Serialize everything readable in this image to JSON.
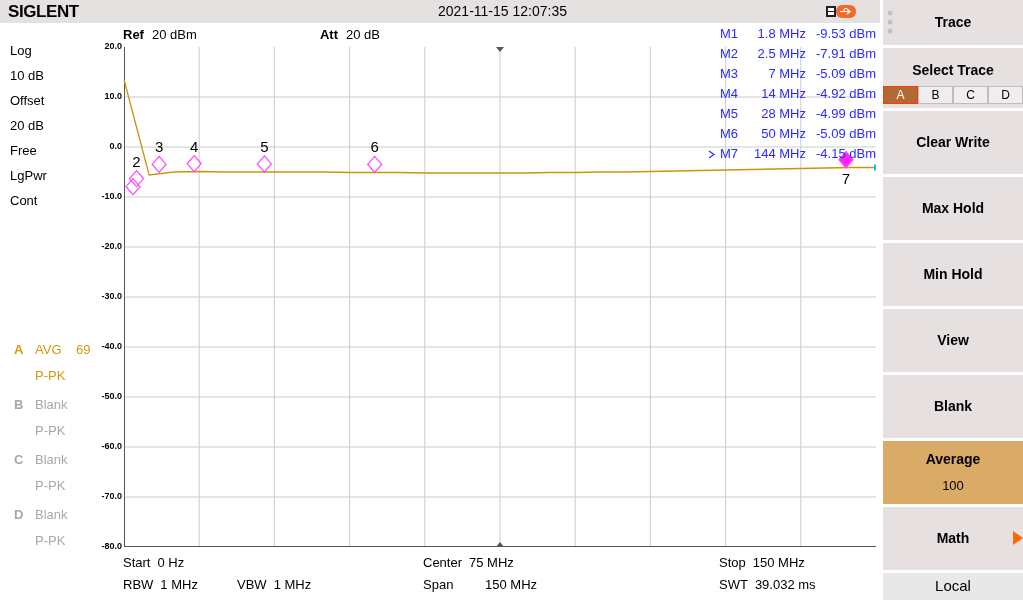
{
  "top_bar": {
    "brand": "SIGLENT",
    "datetime": "2021-11-15 12:07:35"
  },
  "settings": [
    "Log",
    "10 dB",
    "Offset",
    "20 dB",
    "Free",
    "LgPwr",
    "Cont"
  ],
  "traces": [
    {
      "letter": "A",
      "mode": "AVG",
      "count": "69",
      "detector": "P-PK",
      "active": true
    },
    {
      "letter": "B",
      "mode": "Blank",
      "detector": "P-PK",
      "active": false
    },
    {
      "letter": "C",
      "mode": "Blank",
      "detector": "P-PK",
      "active": false
    },
    {
      "letter": "D",
      "mode": "Blank",
      "detector": "P-PK",
      "active": false
    }
  ],
  "header": {
    "ref_label": "Ref",
    "ref_value": "20 dBm",
    "att_label": "Att",
    "att_value": "20 dB"
  },
  "markers": [
    {
      "name": "M1",
      "freq": "1.8 MHz",
      "amplitude": "-9.53 dBm",
      "selected": false
    },
    {
      "name": "M2",
      "freq": "2.5 MHz",
      "amplitude": "-7.91 dBm",
      "selected": false
    },
    {
      "name": "M3",
      "freq": "7 MHz",
      "amplitude": "-5.09 dBm",
      "selected": false
    },
    {
      "name": "M4",
      "freq": "14 MHz",
      "amplitude": "-4.92 dBm",
      "selected": false
    },
    {
      "name": "M5",
      "freq": "28 MHz",
      "amplitude": "-4.99 dBm",
      "selected": false
    },
    {
      "name": "M6",
      "freq": "50 MHz",
      "amplitude": "-5.09 dBm",
      "selected": false
    },
    {
      "name": "M7",
      "freq": "144 MHz",
      "amplitude": "-4.15 dBm",
      "selected": true
    }
  ],
  "plot": {
    "marker_labels": [
      "2",
      "3",
      "4",
      "5",
      "6",
      "7"
    ],
    "chart_data": {
      "type": "line",
      "ylim": [
        -80,
        20
      ],
      "grid": true,
      "yticks": [
        {
          "value": 20,
          "label": "20.0"
        },
        {
          "value": 10,
          "label": "10.0"
        },
        {
          "value": 0,
          "label": "0.0"
        },
        {
          "value": -10,
          "label": "-10.0"
        },
        {
          "value": -20,
          "label": "-20.0"
        },
        {
          "value": -30,
          "label": "-30.0"
        },
        {
          "value": -40,
          "label": "-40.0"
        },
        {
          "value": -50,
          "label": "-50.0"
        },
        {
          "value": -60,
          "label": "-60.0"
        },
        {
          "value": -70,
          "label": "-70.0"
        },
        {
          "value": -80,
          "label": "-80.0"
        }
      ],
      "categories": [
        null,
        null,
        null,
        null,
        null,
        null,
        null,
        null,
        null,
        null,
        null,
        null,
        null,
        null,
        null,
        null,
        null,
        null,
        null,
        null,
        null,
        null,
        null,
        null,
        null,
        null,
        null,
        null,
        null,
        null,
        null
      ],
      "series": [
        {
          "color": "#c8960c",
          "values": [
            13.5,
            -5.6,
            -5,
            -4.9,
            -5,
            -5,
            -5,
            -5,
            -5,
            -5.1,
            -5.1,
            -5.1,
            -5.2,
            -5.2,
            -5.2,
            -5.2,
            -5.2,
            -5.1,
            -5.1,
            -5,
            -5,
            -4.9,
            -4.8,
            -4.7,
            -4.6,
            -4.5,
            -4.4,
            -4.3,
            -4.2,
            -4.1,
            -4.1
          ]
        }
      ]
    }
  },
  "footer": {
    "start": {
      "label": "Start",
      "value": "0 Hz"
    },
    "center": {
      "label": "Center",
      "value": "75 MHz"
    },
    "stop": {
      "label": "Stop",
      "value": "150 MHz"
    },
    "rbw": {
      "label": "RBW",
      "value": "1 MHz"
    },
    "vbw": {
      "label": "VBW",
      "value": "1 MHz"
    },
    "span": {
      "label": "Span",
      "value": "150 MHz"
    },
    "swt": {
      "label": "SWT",
      "value": "39.032 ms"
    }
  },
  "menu": {
    "title": "Trace",
    "select_label": "Select Trace",
    "select_tabs": [
      {
        "label": "A",
        "selected": true
      },
      {
        "label": "B",
        "selected": false
      },
      {
        "label": "C",
        "selected": false
      },
      {
        "label": "D",
        "selected": false
      }
    ],
    "keys": [
      {
        "label": "Clear Write",
        "highlighted": false,
        "submenu": false
      },
      {
        "label": "Max Hold",
        "highlighted": false,
        "submenu": false
      },
      {
        "label": "Min Hold",
        "highlighted": false,
        "submenu": false
      },
      {
        "label": "View",
        "highlighted": false,
        "submenu": false
      },
      {
        "label": "Blank",
        "highlighted": false,
        "submenu": false
      },
      {
        "label": "Average",
        "value": "100",
        "highlighted": true,
        "submenu": false
      },
      {
        "label": "Math",
        "highlighted": false,
        "submenu": true
      }
    ],
    "status": "Local"
  }
}
